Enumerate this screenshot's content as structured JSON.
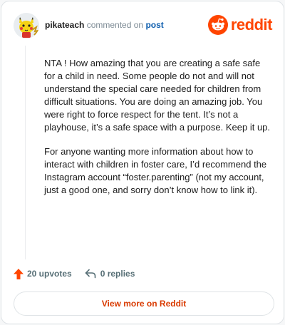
{
  "header": {
    "username": "pikateach",
    "action_text": "commented on",
    "target_link": "post",
    "logo_text": "reddit",
    "brand_color": "#ff4500",
    "avatar_icon": "pikachu-avatar-icon"
  },
  "comment": {
    "paragraphs": [
      "NTA ! How amazing that you are creating a safe safe for a child in need. Some people do not and will not understand the special care needed for children from difficult situations. You are doing an amazing job. You were right to force respect for the tent. It’s not a playhouse, it’s a safe space with a purpose. Keep it up.",
      "For anyone wanting more information about how to interact with children in foster care, I’d recommend the Instagram account “foster.parenting” (not my account, just a good one, and sorry don’t know how to link it)."
    ]
  },
  "footer": {
    "upvotes": "20 upvotes",
    "replies": "0 replies",
    "upvote_color": "#ff4500"
  },
  "cta": {
    "label": "View more on Reddit"
  }
}
